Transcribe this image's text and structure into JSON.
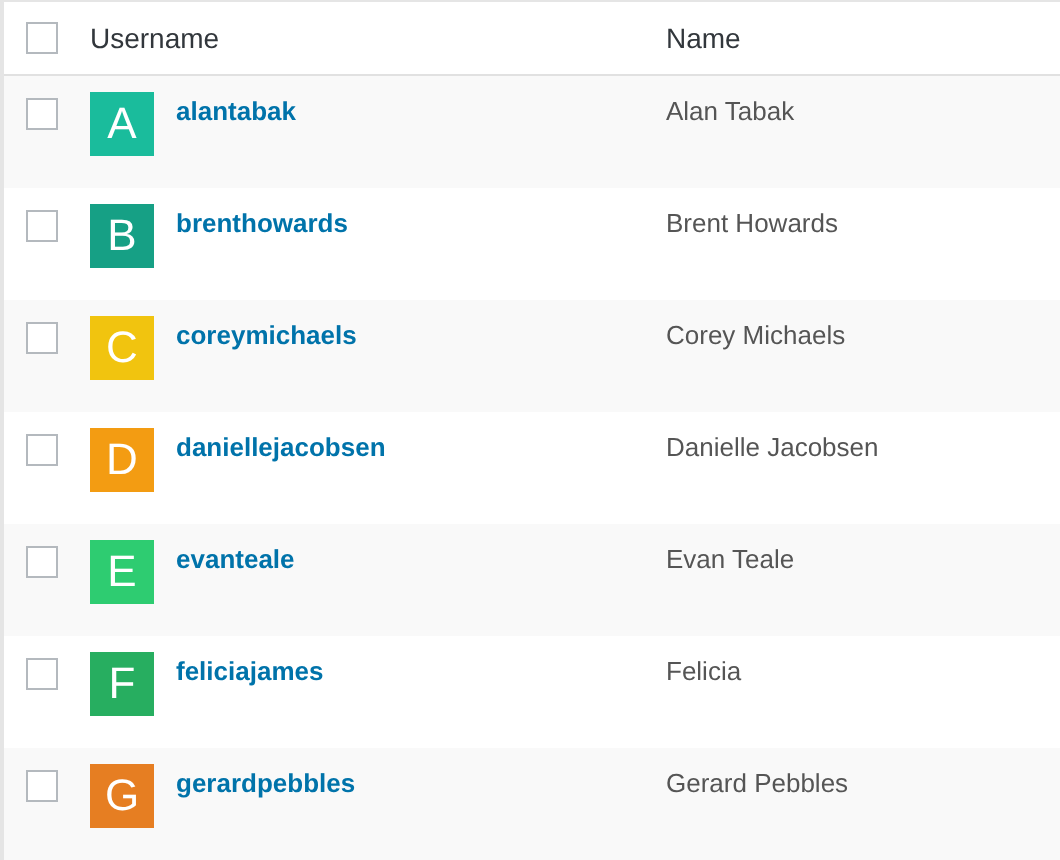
{
  "table": {
    "select_all": {
      "checked": false
    },
    "columns": [
      "Username",
      "Name"
    ],
    "rows": [
      {
        "checked": false,
        "avatar": "A",
        "color": "#1abc9c",
        "username": "alantabak",
        "name": "Alan Tabak"
      },
      {
        "checked": false,
        "avatar": "B",
        "color": "#16a085",
        "username": "brenthowards",
        "name": "Brent Howards"
      },
      {
        "checked": false,
        "avatar": "C",
        "color": "#f1c40f",
        "username": "coreymichaels",
        "name": "Corey Michaels"
      },
      {
        "checked": false,
        "avatar": "D",
        "color": "#f39c12",
        "username": "daniellejacobsen",
        "name": "Danielle Jacobsen"
      },
      {
        "checked": false,
        "avatar": "E",
        "color": "#2ecc71",
        "username": "evanteale",
        "name": "Evan Teale"
      },
      {
        "checked": false,
        "avatar": "F",
        "color": "#27ae60",
        "username": "feliciajames",
        "name": "Felicia"
      },
      {
        "checked": false,
        "avatar": "G",
        "color": "#e67e22",
        "username": "gerardpebbles",
        "name": "Gerard Pebbles"
      }
    ]
  }
}
